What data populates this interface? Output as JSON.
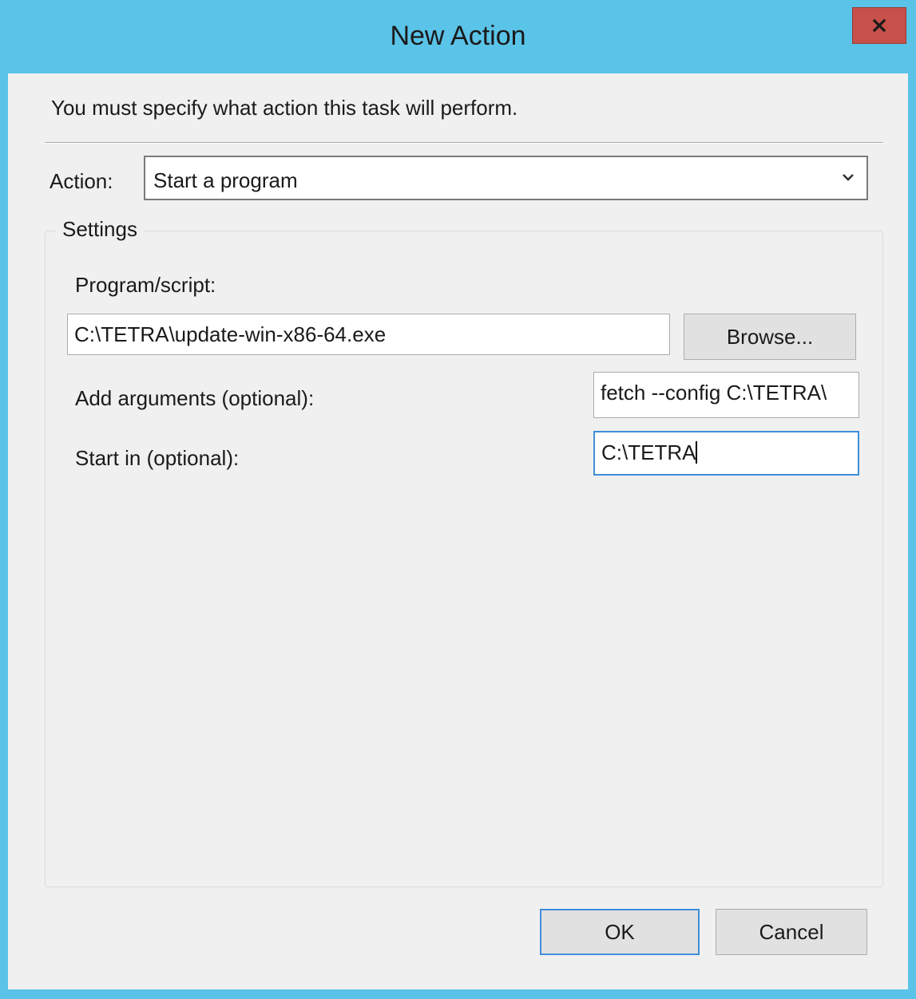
{
  "window": {
    "title": "New Action",
    "close_label": "x"
  },
  "dialog": {
    "instruction": "You must specify what action this task will perform.",
    "action_label": "Action:",
    "action_value": "Start a program",
    "settings_legend": "Settings",
    "program_label": "Program/script:",
    "program_value": "C:\\TETRA\\update-win-x86-64.exe",
    "browse_label": "Browse...",
    "arguments_label": "Add arguments (optional):",
    "arguments_value": "fetch --config C:\\TETRA\\",
    "start_in_label": "Start in (optional):",
    "start_in_value": "C:\\TETRA"
  },
  "footer": {
    "ok_label": "OK",
    "cancel_label": "Cancel"
  },
  "colors": {
    "titlebar": "#5ac3e8",
    "close_button": "#c7504a",
    "client_background": "#f0f0f0",
    "focus_border": "#3f8ed9"
  },
  "icons": {
    "close": "close-icon",
    "dropdown": "chevron-down-icon"
  }
}
